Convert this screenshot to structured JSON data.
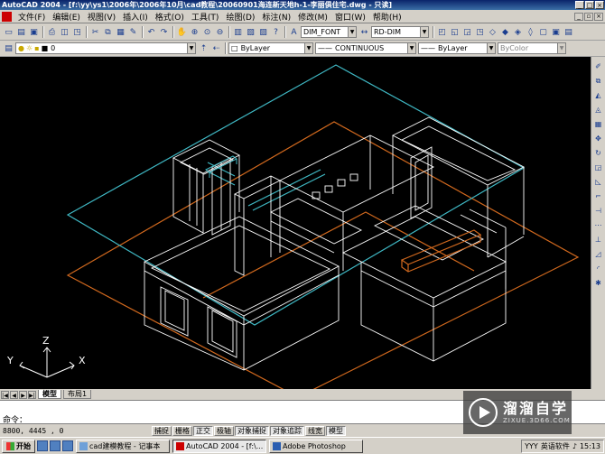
{
  "window": {
    "title": "AutoCAD 2004 - [f:\\yy\\ys1\\2006年\\2006年10月\\cad教程\\20060901海连新天地h-1-李丽俱住宅.dwg - 只读]"
  },
  "menu": [
    "文件(F)",
    "编辑(E)",
    "视图(V)",
    "插入(I)",
    "格式(O)",
    "工具(T)",
    "绘图(D)",
    "标注(N)",
    "修改(M)",
    "窗口(W)",
    "帮助(H)"
  ],
  "toolbar1": {
    "text_style": "DIM_FONT",
    "dim_style": "RD-DIM"
  },
  "toolbar2": {
    "layer": "0",
    "color": "ByLayer",
    "linetype": "CONTINUOUS",
    "lineweight": "ByLayer",
    "plotstyle": "ByColor"
  },
  "ucs": {
    "x": "X",
    "y": "Y",
    "z": "Z"
  },
  "tabs": [
    "模型",
    "布局1"
  ],
  "command": {
    "prompt": "命令："
  },
  "status": {
    "coords": "8800,  4445 , 0",
    "buttons": [
      "捕捉",
      "栅格",
      "正交",
      "极轴",
      "对象捕捉",
      "对象追踪",
      "线宽",
      "模型"
    ],
    "on_buttons": [
      "正交",
      "对象捕捉",
      "对象追踪",
      "模型"
    ]
  },
  "taskbar": {
    "start": "开始",
    "tasks": [
      "cad建模教程 - 记事本",
      "AutoCAD 2004 - [f:\\...",
      "Adobe Photoshop"
    ],
    "tray_user": "YYY",
    "tray_ime": "英语软件",
    "time": "15:13"
  },
  "watermark": {
    "brand": "溜溜自学",
    "url": "ZIXUE.3D66.COM"
  },
  "colors": {
    "cyan_outline": "#3fb8c4",
    "orange_outline": "#d2691e",
    "model_lines": "#ffffff",
    "title_start": "#0a246a",
    "title_end": "#3a6ea5"
  }
}
